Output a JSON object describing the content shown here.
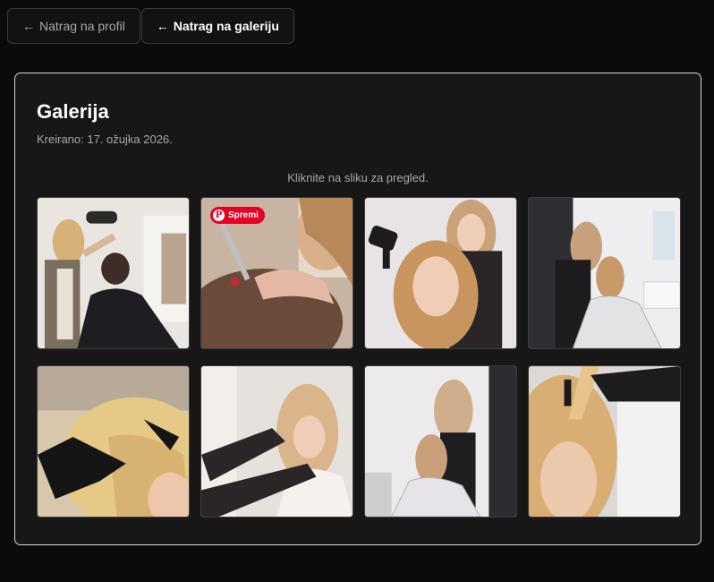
{
  "nav": {
    "back_profile": "Natrag na profil",
    "back_gallery": "Natrag na galeriju",
    "arrow": "←"
  },
  "gallery": {
    "title": "Galerija",
    "created": "Kreirano: 17. ožujka 2026.",
    "hint": "Kliknite na sliku za pregled."
  },
  "pinterest": {
    "label": "Spremi",
    "logo": "P",
    "color": "#e60023"
  },
  "photos": [
    {
      "name": "photo-stylist-blow-drying-man"
    },
    {
      "name": "photo-cutting-man-hair-closeup"
    },
    {
      "name": "photo-blonde-client-hair-dryer"
    },
    {
      "name": "photo-stylist-with-client-salon"
    },
    {
      "name": "photo-gloved-hands-blonde-hair"
    },
    {
      "name": "photo-stylist-arm-client-mirror"
    },
    {
      "name": "photo-stylist-client-mirror-wide"
    },
    {
      "name": "photo-hair-sectioning-closeup"
    }
  ]
}
